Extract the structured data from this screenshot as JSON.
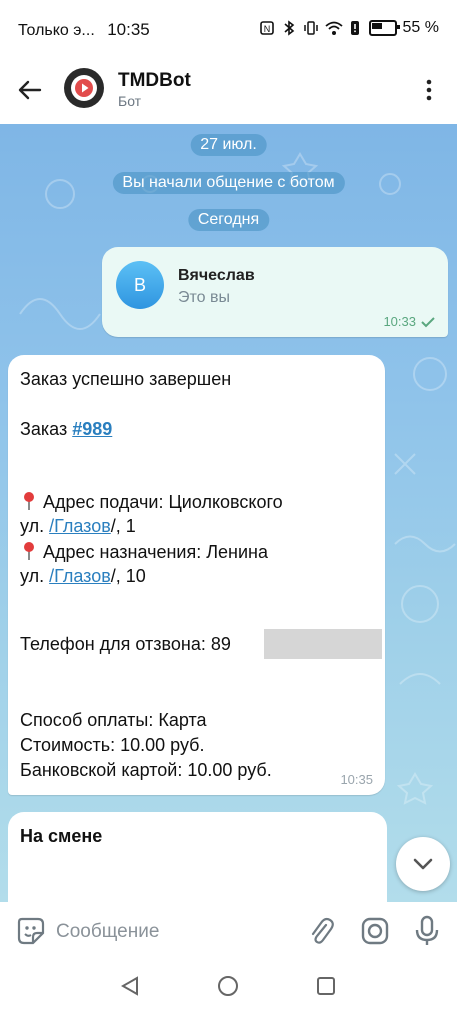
{
  "status_bar": {
    "carrier": "Только э...",
    "time": "10:35",
    "battery": "55 %",
    "icons": [
      "nfc-icon",
      "bluetooth-icon",
      "vibrate-icon",
      "wifi-icon",
      "alert-icon",
      "battery-icon"
    ]
  },
  "header": {
    "title": "TMDBot",
    "subtitle": "Бот"
  },
  "chat": {
    "date_pill": "27 июл.",
    "service_pill": "Вы начали общение с ботом",
    "today_pill": "Сегодня",
    "outgoing": {
      "avatar_letter": "В",
      "contact_name": "Вячеслав",
      "contact_sub": "Это вы",
      "time": "10:33"
    },
    "order_message": {
      "line_completed": "Заказ успешно завершен",
      "order_prefix": "Заказ ",
      "order_link": "#989",
      "pickup_label": "Адрес подачи: Циолковского",
      "pickup_street_prefix": "ул. ",
      "pickup_city_link": "/Глазов",
      "pickup_suffix": "/, 1",
      "dest_label": "Адрес назначения: Ленина",
      "dest_street_prefix": "ул. ",
      "dest_city_link": "/Глазов",
      "dest_suffix": "/, 10",
      "phone": "Телефон для отзвона: 89",
      "payment_method": "Способ оплаты: Карта",
      "cost": "Стоимость: 10.00 руб.",
      "card": "Банковской картой: 10.00 руб.",
      "time": "10:35"
    },
    "next_message": {
      "title": "На смене"
    }
  },
  "input": {
    "placeholder": "Сообщение"
  },
  "colors": {
    "accent": "#2a7fbf",
    "chat_bg_top": "#7fb6e6",
    "chat_bg_bottom": "#b2ddeb",
    "outgoing_bubble": "#eaf9f5",
    "checkmark": "#5aa77f"
  }
}
